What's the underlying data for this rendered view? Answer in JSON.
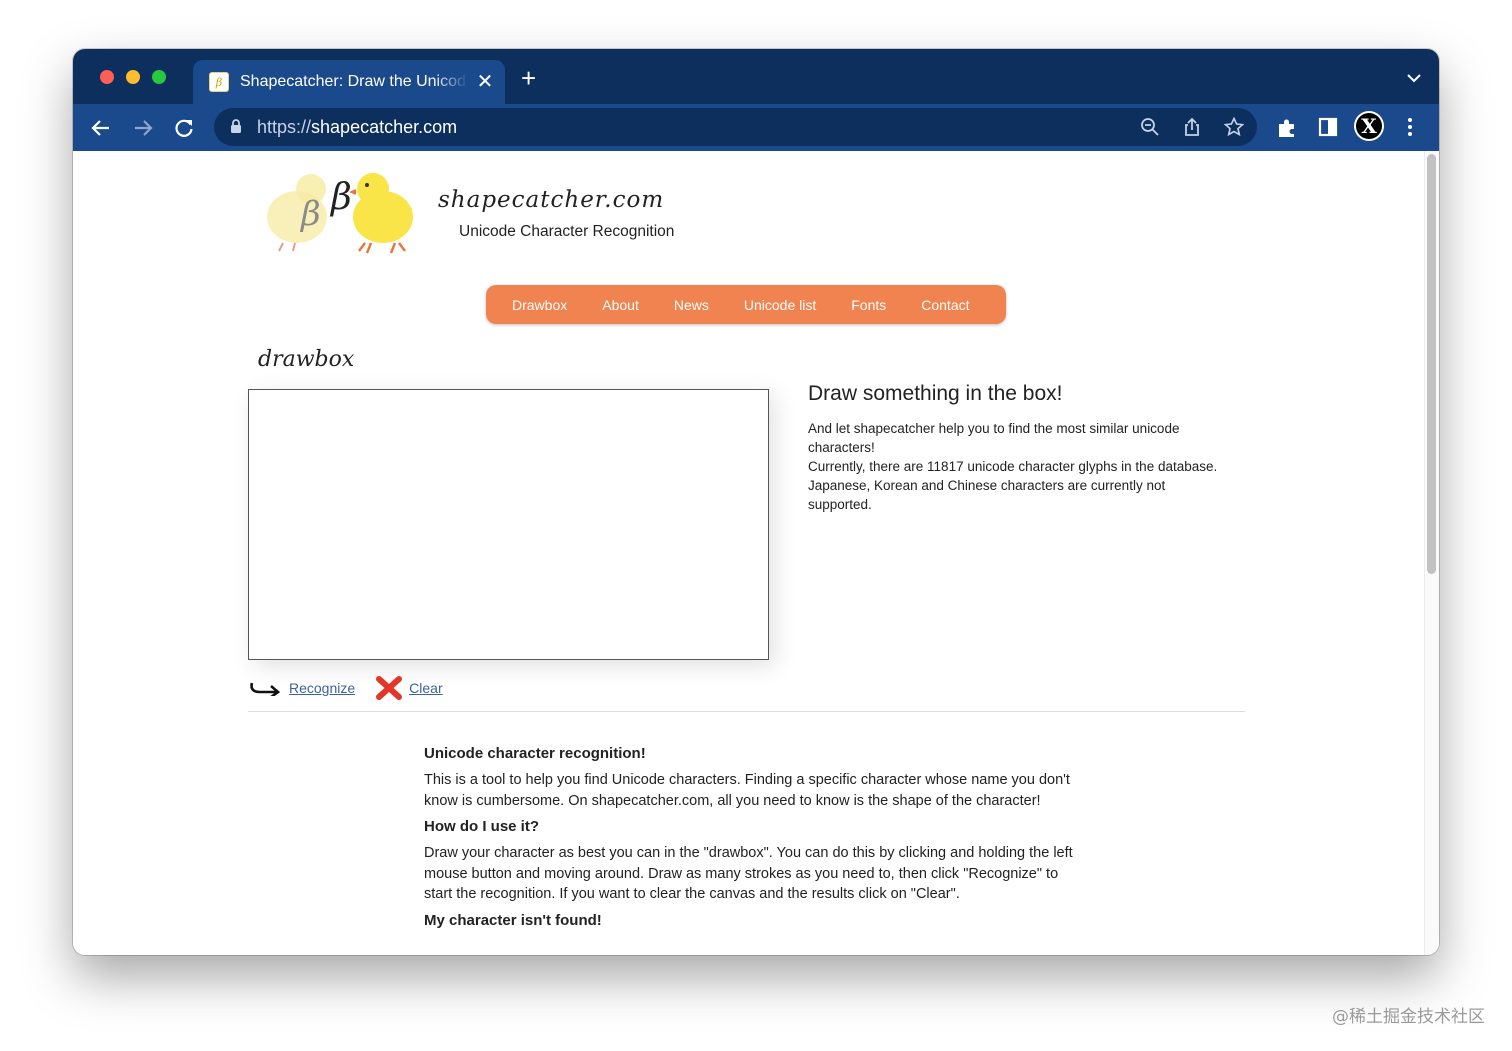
{
  "browser": {
    "tab_title": "Shapecatcher: Draw the Unicode",
    "tab_favicon_glyph": "β",
    "new_tab_symbol": "+",
    "close_symbol": "✕",
    "url_scheme": "https://",
    "url_host": "shapecatcher.com",
    "profile_initial": "X",
    "colors": {
      "tabstrip": "#0d2f5e",
      "toolbar": "#1a4a8c"
    }
  },
  "site": {
    "name": "shapecatcher.com",
    "tagline": "Unicode Character Recognition",
    "logo_glyphs": [
      "β",
      "β"
    ],
    "nav": [
      "Drawbox",
      "About",
      "News",
      "Unicode list",
      "Fonts",
      "Contact"
    ],
    "nav_color": "#f0834f"
  },
  "drawbox": {
    "title": "drawbox",
    "recognize_label": "Recognize",
    "clear_label": "Clear"
  },
  "intro": {
    "title": "Draw something in the box!",
    "lines": [
      "And let shapecatcher help you to find the most similar unicode characters!",
      "Currently, there are 11817 unicode character glyphs in the database.",
      "Japanese, Korean and Chinese characters are currently not supported."
    ]
  },
  "info": {
    "heading1": "Unicode character recognition!",
    "para1": "This is a tool to help you find Unicode characters. Finding a specific character whose name you don't know is cumbersome. On shapecatcher.com, all you need to know is the shape of the character!",
    "heading2": "How do I use it?",
    "para2": "Draw your character as best you can in the \"drawbox\". You can do this by clicking and holding the left mouse button and moving around. Draw as many strokes as you need to, then click \"Recognize\" to start the recognition. If you want to clear the canvas and the results click on \"Clear\".",
    "heading3": "My character isn't found!"
  },
  "watermark": "@稀土掘金技术社区"
}
